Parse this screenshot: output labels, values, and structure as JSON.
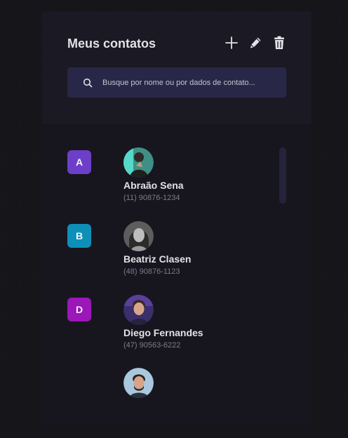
{
  "header": {
    "title": "Meus contatos",
    "actions": {
      "add_icon": "plus-icon",
      "edit_icon": "pencil-icon",
      "delete_icon": "trash-icon"
    }
  },
  "search": {
    "placeholder": "Busque por nome ou por dados de contato...",
    "icon": "search-icon"
  },
  "groups": [
    {
      "letter": "A",
      "color": "#6d3fc8",
      "contact": {
        "name": "Abraão Sena",
        "phone": "(11) 90876-1234"
      }
    },
    {
      "letter": "B",
      "color": "#0e8fb8",
      "contact": {
        "name": "Beatriz Clasen",
        "phone": "(48) 90876-1123"
      }
    },
    {
      "letter": "D",
      "color": "#9b17b8",
      "contact": {
        "name": "Diego Fernandes",
        "phone": "(47) 90563-6222"
      }
    },
    {
      "letter": "",
      "color": "",
      "contact": {
        "name": "",
        "phone": ""
      }
    }
  ],
  "colors": {
    "background": "#151419",
    "panel": "#17161f",
    "header": "#1a1924",
    "search_bg": "#282747",
    "text": "#e1e1e6",
    "muted": "#7c7c8a"
  }
}
